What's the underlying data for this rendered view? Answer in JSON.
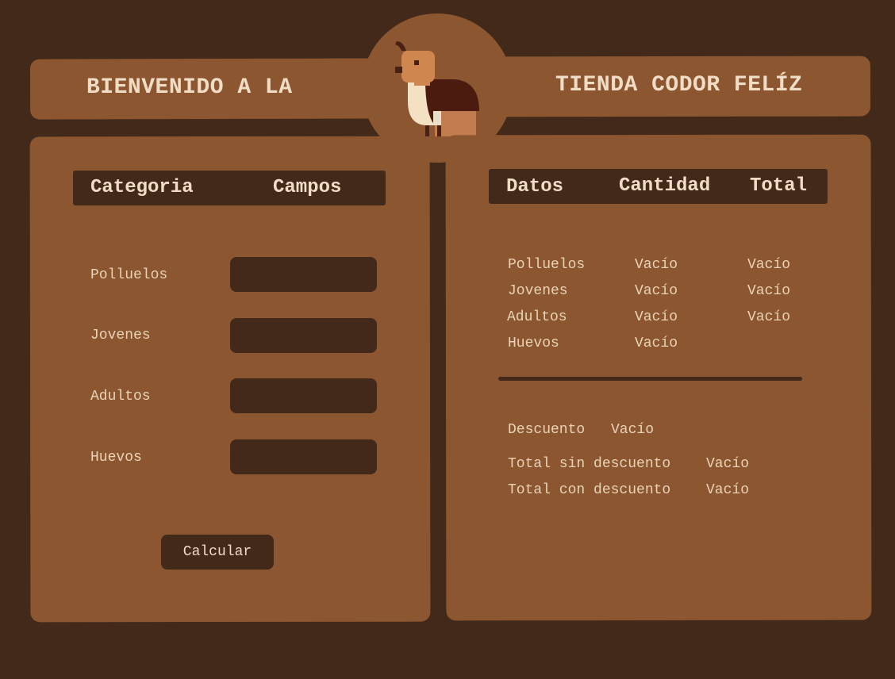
{
  "header": {
    "title_left": "BIENVENIDO A LA",
    "title_right": "TIENDA CODOR FELÍZ",
    "logo_icon": "quail-icon"
  },
  "form": {
    "headers": {
      "category": "Categoria",
      "fields": "Campos"
    },
    "rows": [
      {
        "label": "Polluelos",
        "value": ""
      },
      {
        "label": "Jovenes",
        "value": ""
      },
      {
        "label": "Adultos",
        "value": ""
      },
      {
        "label": "Huevos",
        "value": ""
      }
    ],
    "button_label": "Calcular"
  },
  "results": {
    "headers": {
      "data": "Datos",
      "quantity": "Cantidad",
      "total": "Total"
    },
    "rows": [
      {
        "label": "Polluelos",
        "quantity": "Vacío",
        "total": "Vacío"
      },
      {
        "label": "Jovenes",
        "quantity": "Vacío",
        "total": "Vacío"
      },
      {
        "label": "Adultos",
        "quantity": "Vacío",
        "total": "Vacío"
      },
      {
        "label": "Huevos",
        "quantity": "Vacío",
        "total": ""
      }
    ],
    "discount": {
      "label": "Descuento",
      "value": "Vacío"
    },
    "total_without_discount": {
      "label": "Total sin descuento",
      "value": "Vacío"
    },
    "total_with_discount": {
      "label": "Total con descuento",
      "value": "Vacío"
    }
  },
  "colors": {
    "background": "#42291a",
    "panel": "#8b5630",
    "text": "#f1ddc6"
  }
}
